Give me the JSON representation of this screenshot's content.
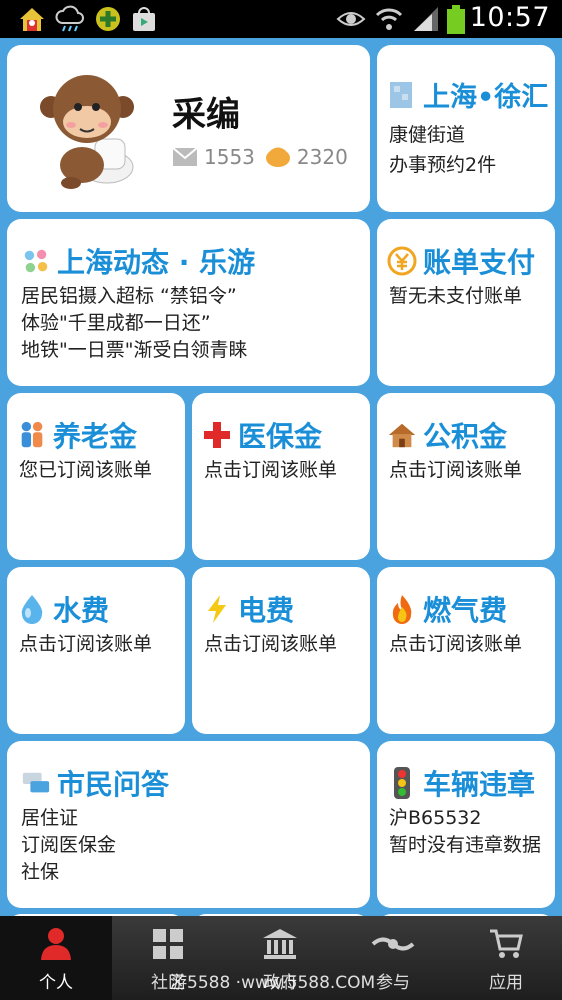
{
  "status_bar": {
    "time": "10:57"
  },
  "profile": {
    "name": "采编",
    "mail_count": "1553",
    "coin_count": "2320"
  },
  "location": {
    "title": "上海•徐汇",
    "street": "康健街道",
    "appointments": "办事预约2件"
  },
  "news": {
    "title": "上海动态 · 乐游",
    "items": [
      "居民铝摄入超标 “禁铝令”",
      "体验\"千里成都一日还”",
      "地铁\"一日票\"渐受白领青睐"
    ]
  },
  "bill_pay": {
    "title": "账单支付",
    "status": "暂无未支付账单"
  },
  "tiles": [
    {
      "title": "养老金",
      "status": "您已订阅该账单"
    },
    {
      "title": "医保金",
      "status": "点击订阅该账单"
    },
    {
      "title": "公积金",
      "status": "点击订阅该账单"
    },
    {
      "title": "水费",
      "status": "点击订阅该账单"
    },
    {
      "title": "电费",
      "status": "点击订阅该账单"
    },
    {
      "title": "燃气费",
      "status": "点击订阅该账单"
    }
  ],
  "qa": {
    "title": "市民问答",
    "items": [
      "居住证",
      "订阅医保金",
      "社保"
    ]
  },
  "traffic": {
    "title": "车辆违章",
    "plate": "沪B65532",
    "status": "暂时没有违章数据"
  },
  "nav": [
    {
      "label": "个人"
    },
    {
      "label": "社区"
    },
    {
      "label": "政府"
    },
    {
      "label": "参与"
    },
    {
      "label": "应用"
    }
  ],
  "watermark": "游5588 ·www.5588.COM",
  "colors": {
    "background": "#4aa3df",
    "accent": "#1a8fd8",
    "nav_bg": "#2a2a2a"
  }
}
